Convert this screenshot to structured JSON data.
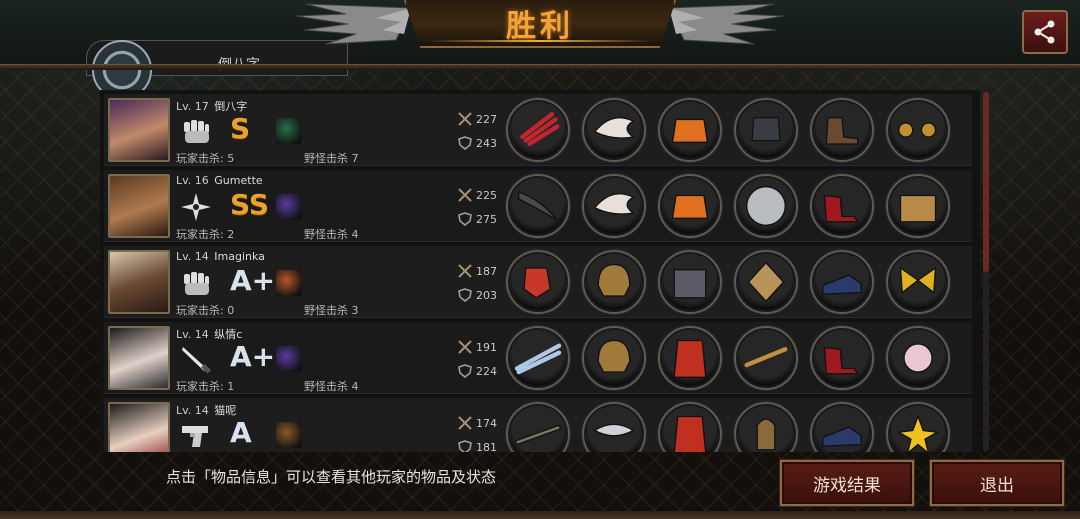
{
  "header": {
    "title": "胜利",
    "profile_name": "倒八字"
  },
  "players": [
    {
      "level": "Lv. 17",
      "name": "倒八字",
      "weapon": "fist-icon",
      "rank": "S",
      "player_kills_label": "玩家击杀: 5",
      "monster_kills_label": "野怪击杀 7",
      "attack": "227",
      "defense": "243",
      "items": [
        "claw",
        "wings",
        "flame-armor",
        "gauntlet",
        "boots",
        "goggles"
      ]
    },
    {
      "level": "Lv. 16",
      "name": "Gumette",
      "weapon": "shuriken-icon",
      "rank": "SS",
      "player_kills_label": "玩家击杀: 2",
      "monster_kills_label": "野怪击杀 4",
      "attack": "225",
      "defense": "275",
      "items": [
        "boomerang",
        "wings",
        "flame-armor",
        "metal-disc",
        "heels",
        "treasure-box"
      ]
    },
    {
      "level": "Lv. 14",
      "name": "Imaginka",
      "weapon": "fist-icon",
      "rank": "A+",
      "player_kills_label": "玩家击杀: 0",
      "monster_kills_label": "野怪击杀 3",
      "attack": "187",
      "defense": "203",
      "items": [
        "red-glove",
        "helmet",
        "armor",
        "charm",
        "sneakers",
        "ribbon"
      ]
    },
    {
      "level": "Lv. 14",
      "name": "纵情c",
      "weapon": "knife-icon",
      "rank": "A+",
      "player_kills_label": "玩家击杀: 1",
      "monster_kills_label": "野怪击杀 4",
      "attack": "191",
      "defense": "224",
      "items": [
        "blades",
        "helmet",
        "red-suit",
        "stick",
        "heels",
        "pearl"
      ]
    },
    {
      "level": "Lv. 14",
      "name": "猫呢",
      "weapon": "pistol-icon",
      "rank": "A",
      "player_kills_label": "",
      "monster_kills_label": "",
      "attack": "174",
      "defense": "181",
      "items": [
        "rifle",
        "mask",
        "red-suit",
        "bullet",
        "sneakers",
        "flower"
      ]
    }
  ],
  "footer": {
    "hint": "点击「物品信息」可以查看其他玩家的物品及状态",
    "results_button": "游戏结果",
    "exit_button": "退出"
  },
  "colors": {
    "title": "#f2a43a",
    "button_bg": "#5a1c16",
    "rank_gold": "#e9a230"
  }
}
